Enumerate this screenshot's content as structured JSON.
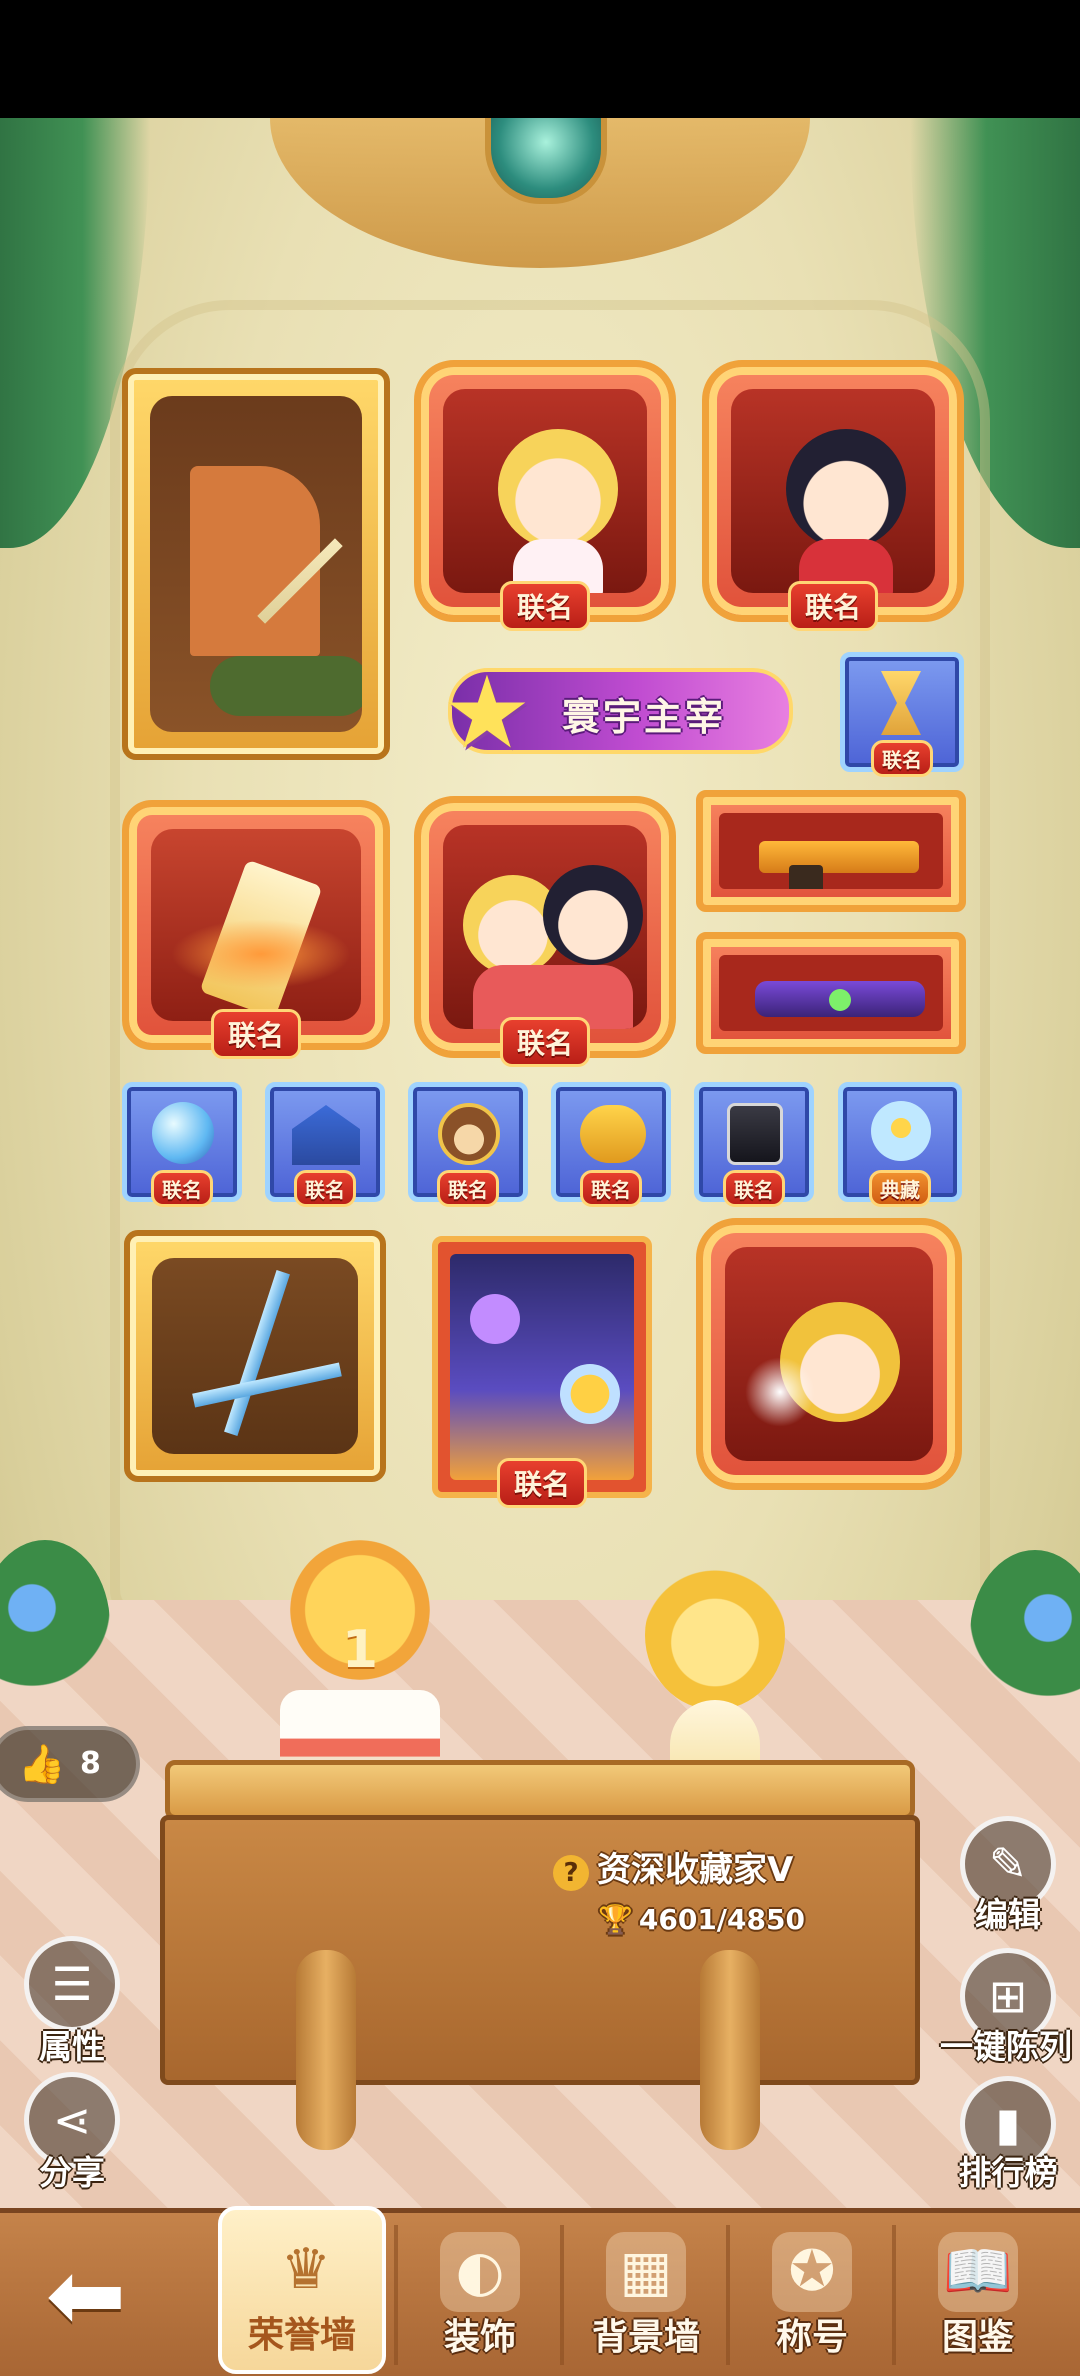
{
  "collection_wall": {
    "frames": [
      {
        "id": "windmill-house",
        "label": ""
      },
      {
        "id": "blonde-girl",
        "label": "联名"
      },
      {
        "id": "dark-hair-boy",
        "label": "联名"
      },
      {
        "id": "phoenix-scroll",
        "label": "联名"
      },
      {
        "id": "couple",
        "label": "联名"
      },
      {
        "id": "gold-gun",
        "label": ""
      },
      {
        "id": "purple-gun",
        "label": ""
      },
      {
        "id": "space-card",
        "label": "联名"
      },
      {
        "id": "warrior",
        "label": ""
      },
      {
        "id": "twin-blades",
        "label": ""
      }
    ],
    "small_badges": [
      {
        "id": "hourglass",
        "label": "联名"
      },
      {
        "id": "crystal-ball",
        "label": "联名"
      },
      {
        "id": "blue-house",
        "label": "联名"
      },
      {
        "id": "bear-badge",
        "label": "联名"
      },
      {
        "id": "yellow-bear",
        "label": "联名"
      },
      {
        "id": "robot-box",
        "label": "联名"
      },
      {
        "id": "flower-globe",
        "label": "典藏"
      }
    ],
    "title_banner": "寰宇主宰"
  },
  "likes": {
    "count": "8"
  },
  "rank": {
    "title": "资深收藏家V",
    "score": "4601/4850"
  },
  "side_buttons": {
    "edit": "编辑",
    "arrange": "一键陈列",
    "leaderboard": "排行榜",
    "attributes": "属性",
    "share": "分享"
  },
  "nav": {
    "tabs": [
      {
        "label": "荣誉墙"
      },
      {
        "label": "装饰"
      },
      {
        "label": "背景墙"
      },
      {
        "label": "称号"
      },
      {
        "label": "图鉴"
      }
    ]
  },
  "colors": {
    "gold": "#f5c04a",
    "red": "#e0513a",
    "blue": "#4d63d6",
    "nav": "#b8723d"
  }
}
